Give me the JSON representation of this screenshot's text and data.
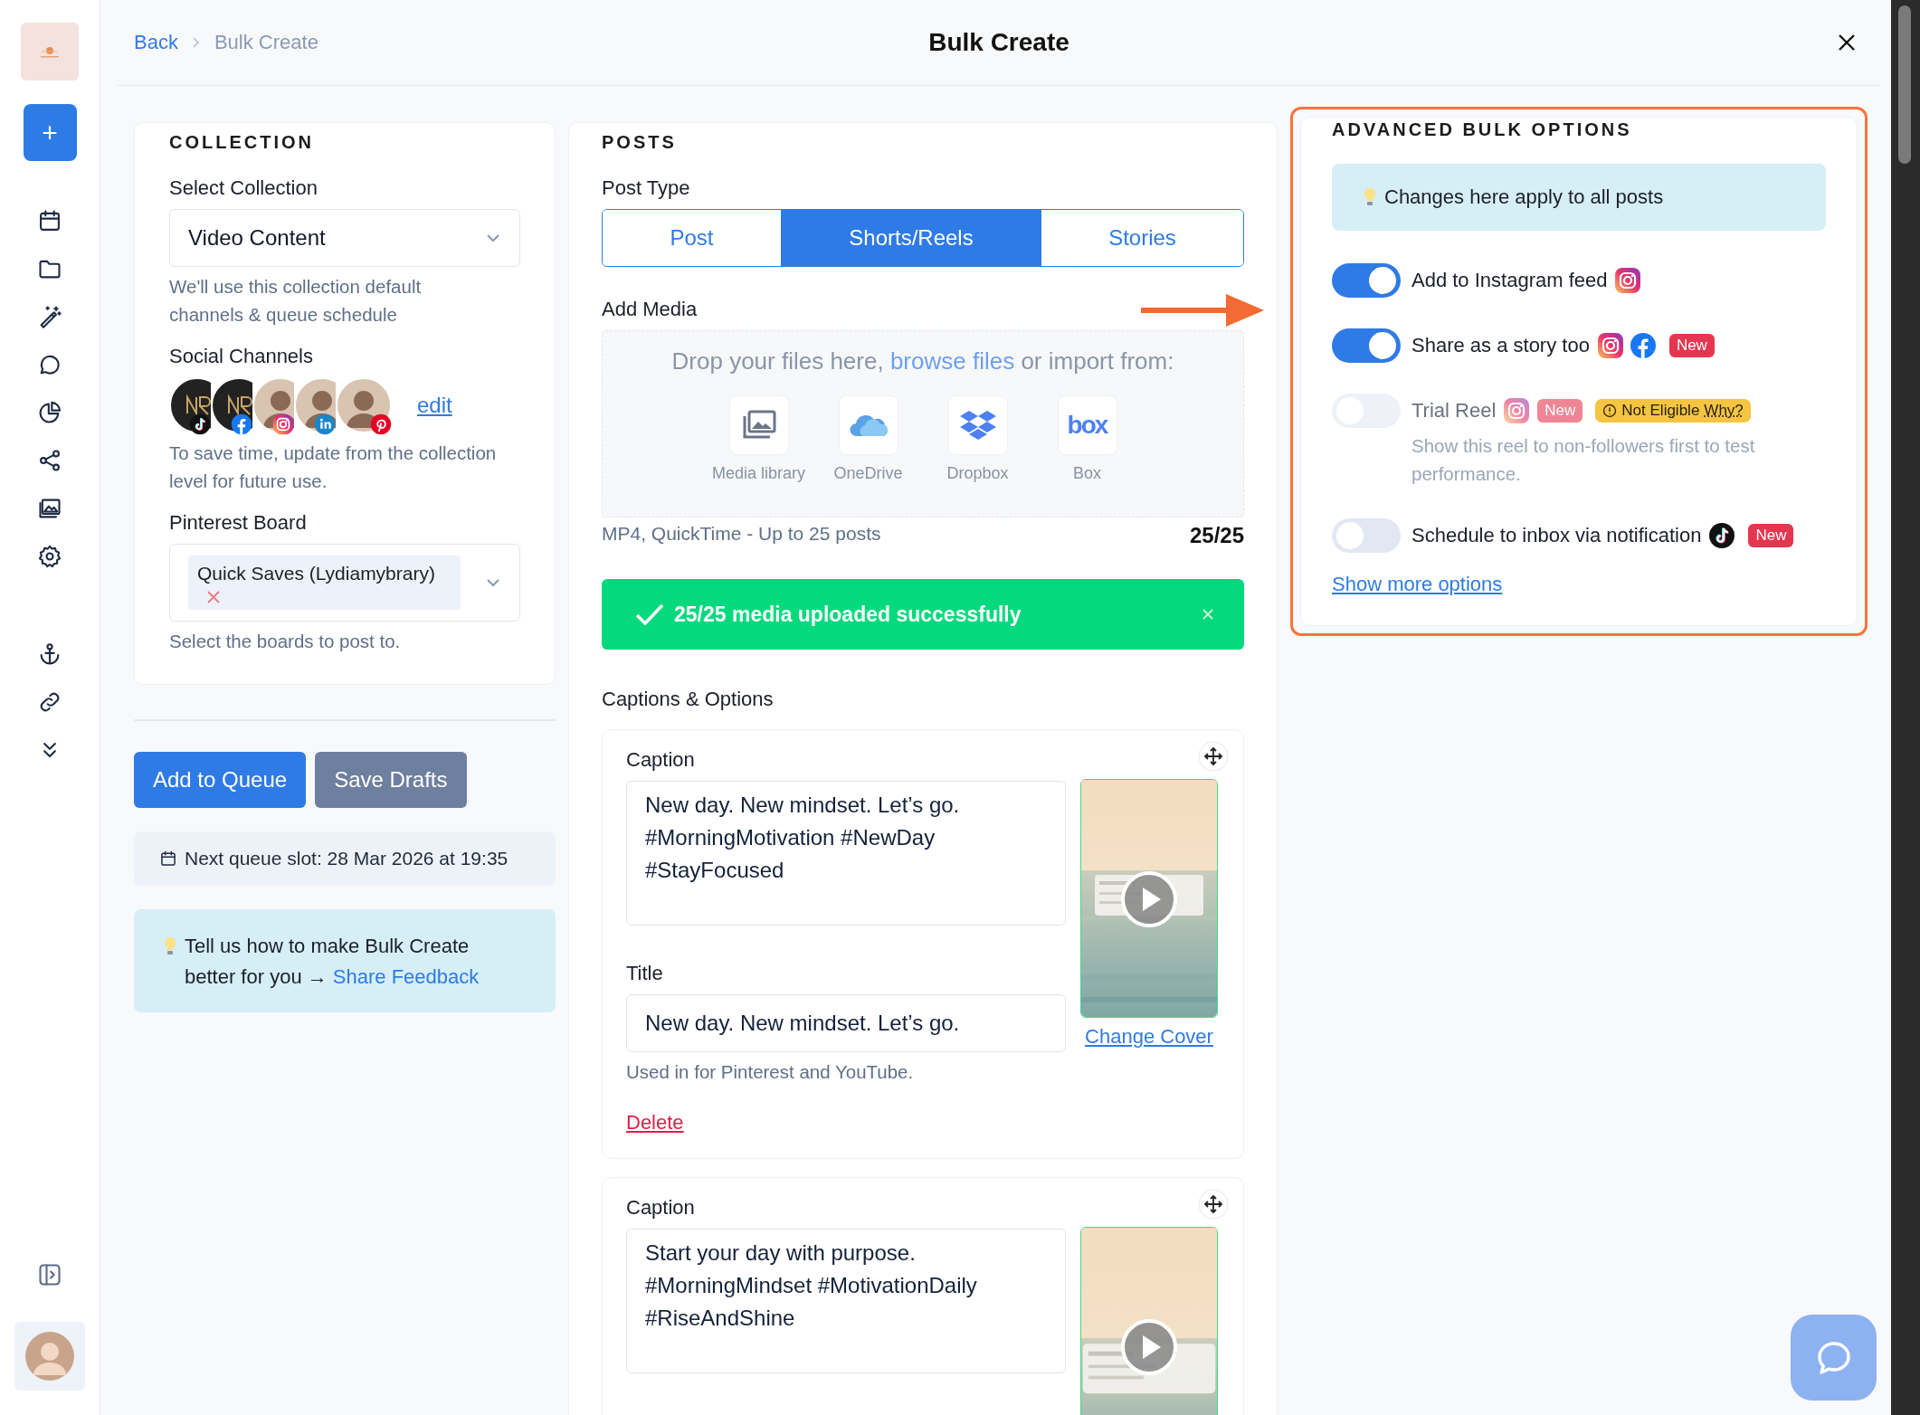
{
  "sidebar": {
    "create_button": "+"
  },
  "header": {
    "back": "Back",
    "breadcrumb": "Bulk Create",
    "title": "Bulk Create"
  },
  "collection": {
    "heading": "COLLECTION",
    "select_label": "Select Collection",
    "select_value": "Video Content",
    "select_help": "We'll use this collection default channels & queue schedule",
    "channels_label": "Social Channels",
    "channels": [
      {
        "kind": "tiktok"
      },
      {
        "kind": "facebook"
      },
      {
        "kind": "instagram"
      },
      {
        "kind": "linkedin"
      },
      {
        "kind": "pinterest"
      }
    ],
    "edit": "edit",
    "channels_help": "To save time, update from the collection level for future use.",
    "board_label": "Pinterest Board",
    "boards": [
      "Quick Saves (Lydiamybrary)"
    ],
    "board_help": "Select the boards to post to."
  },
  "actions": {
    "buttons": [
      {
        "label": "Add to Queue",
        "kind": "primary"
      },
      {
        "label": "Save Drafts",
        "kind": "secondary"
      }
    ],
    "next_slot": "Next queue slot: 28 Mar 2026 at 19:35",
    "feedback": {
      "text": "Tell us how to make Bulk Create better for you →",
      "link": "Share Feedback"
    }
  },
  "posts": {
    "heading": "POSTS",
    "post_type_label": "Post Type",
    "tabs": [
      {
        "label": "Post",
        "selected": false
      },
      {
        "label": "Shorts/Reels",
        "selected": true
      },
      {
        "label": "Stories",
        "selected": false
      }
    ],
    "add_media_label": "Add Media",
    "drop_text": "Drop your files here,",
    "drop_link": "browse files",
    "drop_tail": "or import from:",
    "sources": [
      {
        "kind": "media",
        "label": "Media library"
      },
      {
        "kind": "onedrive",
        "label": "OneDrive"
      },
      {
        "kind": "dropbox",
        "label": "Dropbox"
      },
      {
        "kind": "box",
        "label": "Box",
        "logo_text": "box"
      }
    ],
    "formats": "MP4, QuickTime - Up to 25 posts",
    "count": "25/25",
    "upload_banner": "25/25 media uploaded successfully",
    "captions_label": "Captions & Options",
    "items": [
      {
        "caption_label": "Caption",
        "caption": "New day. New mindset. Let’s go.\n#MorningMotivation #NewDay\n#StayFocused",
        "title_label": "Title",
        "title": "New day. New mindset. Let’s go.",
        "title_help": "Used in for Pinterest and YouTube.",
        "change_cover": "Change Cover",
        "delete": "Delete"
      },
      {
        "caption_label": "Caption",
        "caption": "Start your day with purpose.\n#MorningMindset #MotivationDaily\n#RiseAndShine"
      }
    ]
  },
  "advanced": {
    "highlighted": true,
    "heading": "ADVANCED BULK OPTIONS",
    "notice": "Changes here apply to all posts",
    "options": [
      {
        "label": "Add to Instagram feed",
        "on": true,
        "disabled": false,
        "networks": [
          {
            "kind": "instagram"
          }
        ]
      },
      {
        "label": "Share as a story too",
        "on": true,
        "disabled": false,
        "networks": [
          {
            "kind": "instagram"
          },
          {
            "kind": "facebook"
          }
        ],
        "badges": [
          "New"
        ]
      },
      {
        "label": "Trial Reel",
        "on": false,
        "disabled": true,
        "networks": [
          {
            "kind": "instagram"
          }
        ],
        "badges": [
          "New"
        ],
        "eligibility": {
          "text": "Not Eligible",
          "link": "Why?"
        },
        "help": "Show this reel to non-followers first to test performance."
      },
      {
        "label": "Schedule to inbox via notification",
        "on": false,
        "disabled": false,
        "networks": [
          {
            "kind": "tiktok"
          }
        ],
        "badges": [
          "New"
        ]
      }
    ],
    "show_more": "Show more options"
  }
}
